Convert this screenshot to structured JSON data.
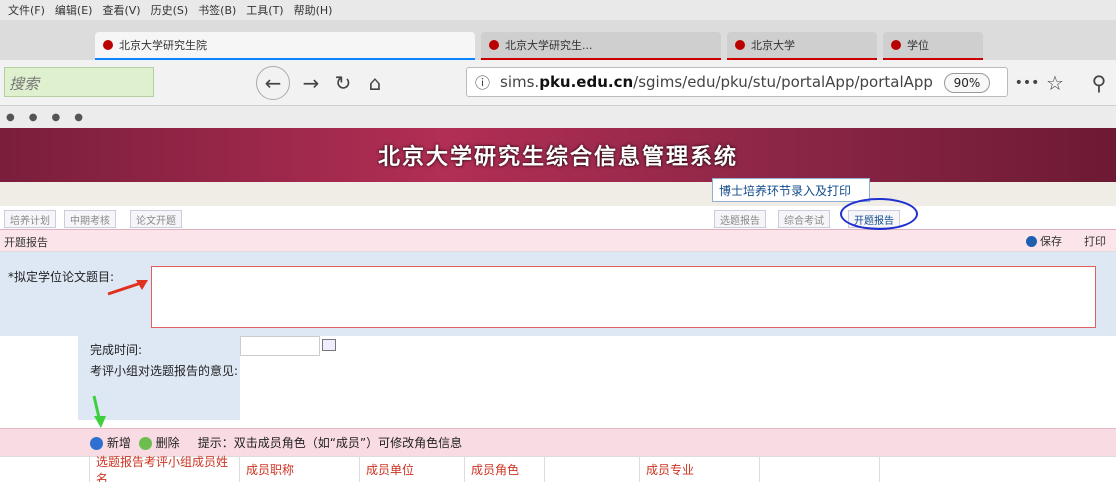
{
  "browser": {
    "menu": [
      "文件(F)",
      "编辑(E)",
      "查看(V)",
      "历史(S)",
      "书签(B)",
      "工具(T)",
      "帮助(H)"
    ],
    "tabs": [
      {
        "label": "北京大学研究生院",
        "active": true
      },
      {
        "label": "北京大学研究生...",
        "active": false
      },
      {
        "label": "北京大学",
        "active": false
      },
      {
        "label": "学位",
        "active": false
      }
    ],
    "search_placeholder": "搜索",
    "url_prefix": "sims.",
    "url_domain": "pku.edu.cn",
    "url_path": "/sgims/edu/pku/stu/portalApp/portalApp",
    "zoom": "90%",
    "more": "•••",
    "star": "☆"
  },
  "app": {
    "banner_title": "北京大学研究生综合信息管理系统",
    "module_tab": "博士培养环节录入及打印",
    "subtabs": [
      "培养计划",
      "中期考核",
      "论文开题",
      "选题报告",
      "综合考试",
      "开题报告"
    ],
    "toolbar_left": "开题报告",
    "save": "保存",
    "print": "打印"
  },
  "form": {
    "title_label": "*拟定学位论文题目:",
    "date_label": "完成时间:",
    "opinion_label": "考评小组对选题报告的意见:"
  },
  "members": {
    "add": "新增",
    "delete": "删除",
    "hint": "提示：双击成员角色（如“成员”）可修改角色信息",
    "columns": [
      "选题报告考评小组成员姓名",
      "成员职称",
      "成员单位",
      "成员角色",
      "",
      "成员专业",
      ""
    ]
  },
  "colors": {
    "accent": "#0a84ff",
    "banner": "#b22e54",
    "form_bg": "#dee8f5",
    "annotation_red": "#e0301e",
    "annotation_green": "#3cd13c"
  }
}
